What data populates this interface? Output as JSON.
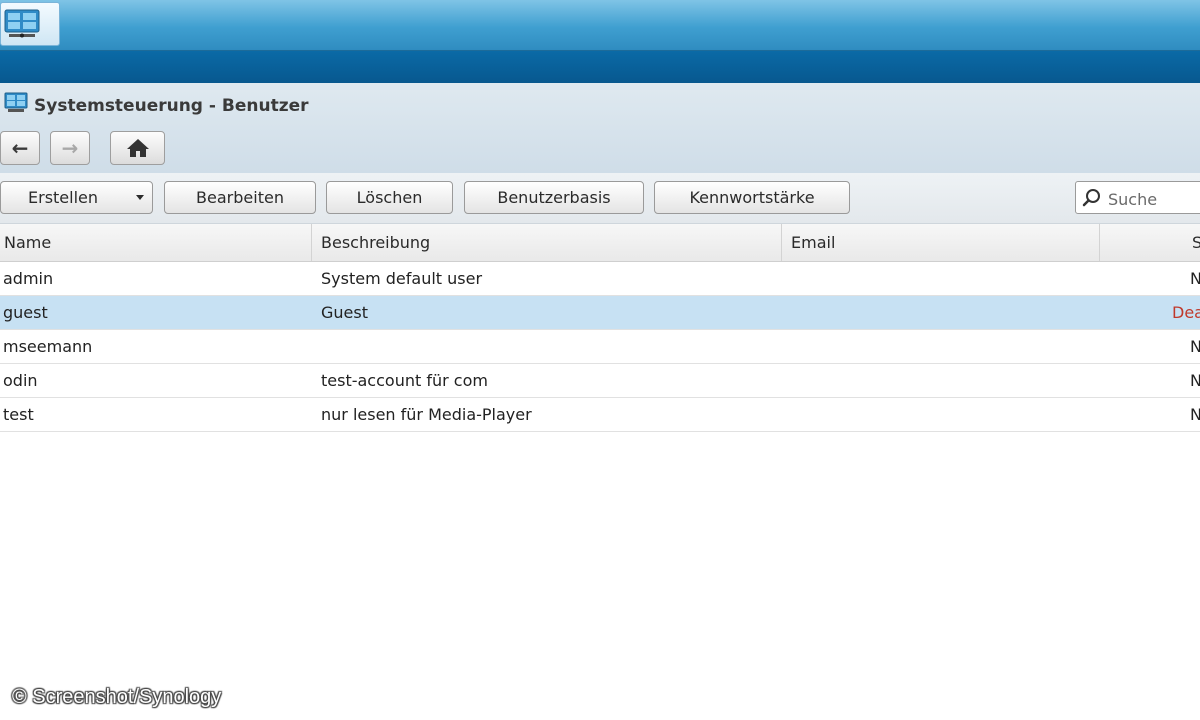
{
  "window": {
    "title": "Systemsteuerung - Benutzer",
    "nav": {
      "back": "←",
      "forward": "→"
    }
  },
  "taskbar": {
    "app_icon": "control-panel-icon"
  },
  "toolbar": {
    "create_label": "Erstellen",
    "edit_label": "Bearbeiten",
    "delete_label": "Löschen",
    "user_base_label": "Benutzerbasis",
    "password_strength_label": "Kennwortstärke",
    "search_placeholder": "Suche"
  },
  "table": {
    "columns": [
      "Name",
      "Beschreibung",
      "Email",
      "S"
    ],
    "rows": [
      {
        "name": "admin",
        "description": "System default user",
        "email": "",
        "status": "N",
        "selected": false
      },
      {
        "name": "guest",
        "description": "Guest",
        "email": "",
        "status": "Dea",
        "selected": true
      },
      {
        "name": "mseemann",
        "description": "",
        "email": "",
        "status": "N",
        "selected": false
      },
      {
        "name": "odin",
        "description": "test-account für com",
        "email": "",
        "status": "N",
        "selected": false
      },
      {
        "name": "test",
        "description": "nur lesen für Media-Player",
        "email": "",
        "status": "N",
        "selected": false
      }
    ]
  },
  "footer": {
    "copyright": "© Screenshot/Synology"
  },
  "colors": {
    "taskbar": "#3f9fd0",
    "band": "#07588f",
    "selected_row": "#c7e1f3",
    "disabled_status": "#c0392b"
  }
}
